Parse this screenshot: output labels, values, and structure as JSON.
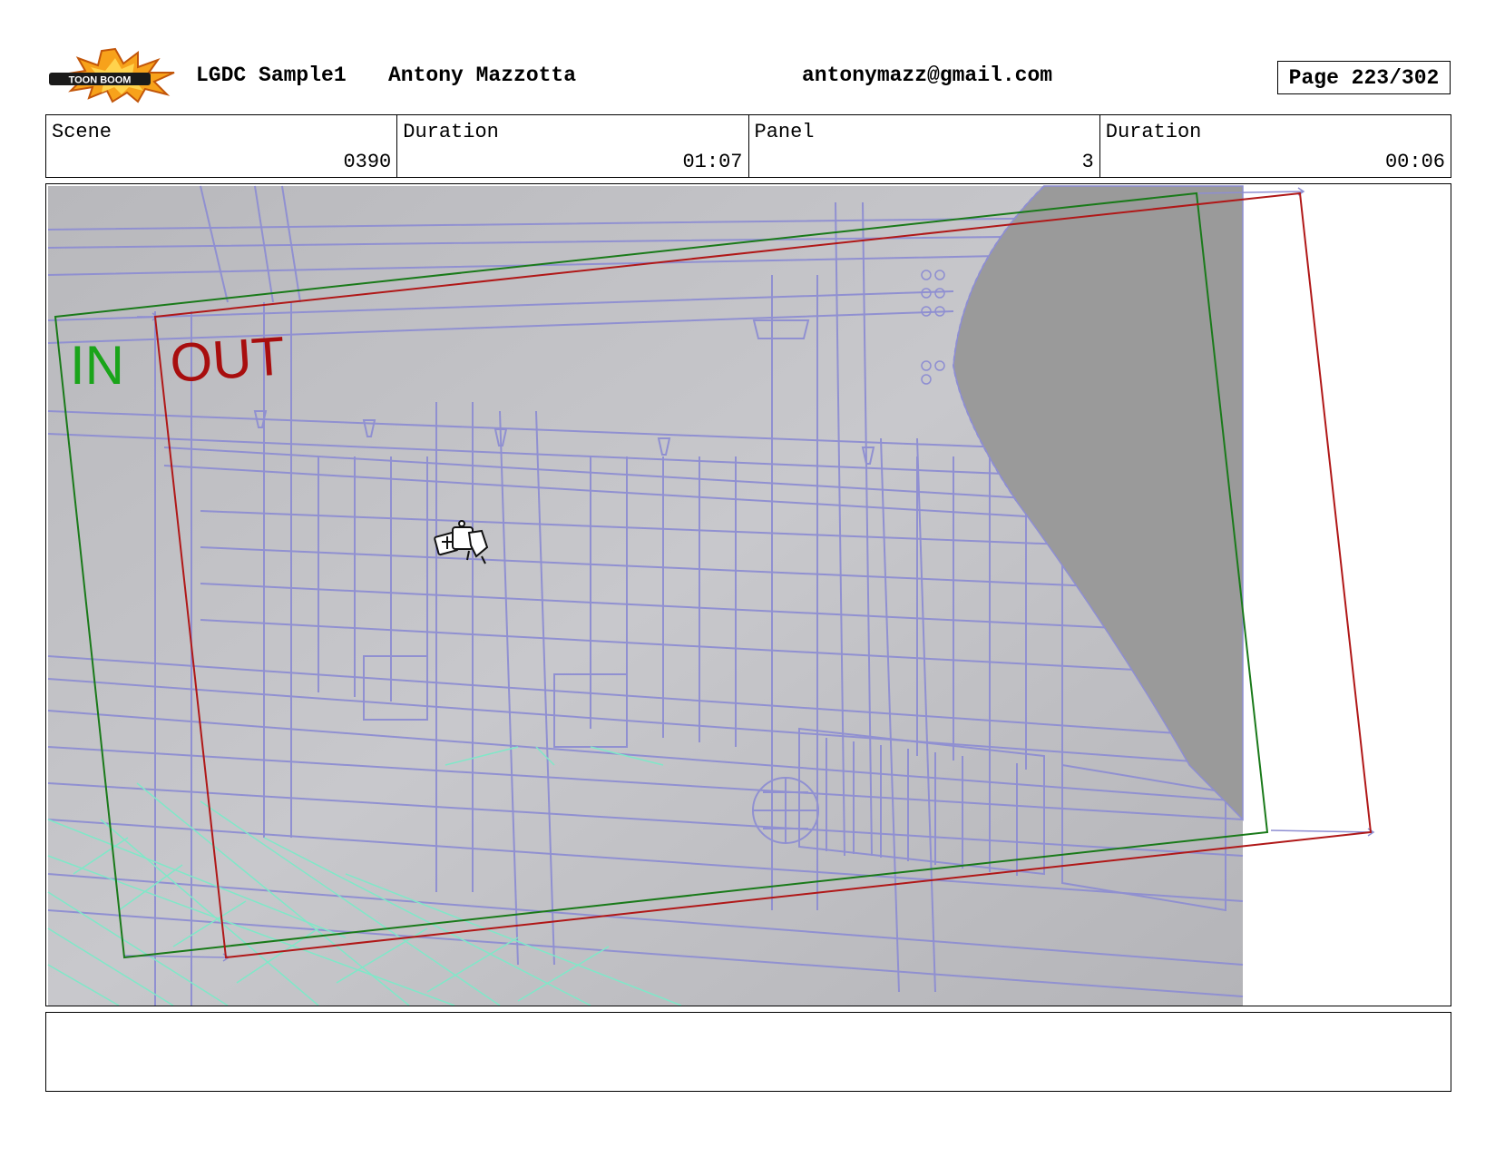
{
  "header": {
    "logo_text": "TOON BOOM",
    "project": "LGDC Sample1",
    "author": "Antony Mazzotta",
    "email": "antonymazz@gmail.com",
    "page": "Page 223/302"
  },
  "info": {
    "scene_label": "Scene",
    "scene_value": "0390",
    "scene_duration_label": "Duration",
    "scene_duration_value": "01:07",
    "panel_label": "Panel",
    "panel_value": "3",
    "panel_duration_label": "Duration",
    "panel_duration_value": "00:06"
  },
  "panel_image": {
    "in_label": "IN",
    "out_label": "OUT",
    "colors": {
      "in_frame": "#1a7a1a",
      "in_text": "#1aa41a",
      "out_frame": "#b01818",
      "out_text": "#a80e0e",
      "wireframe": "#8e8ed2",
      "floor_grid": "#7fe8c8",
      "background": "#c0c0c0"
    }
  },
  "notes": {
    "text": ""
  }
}
